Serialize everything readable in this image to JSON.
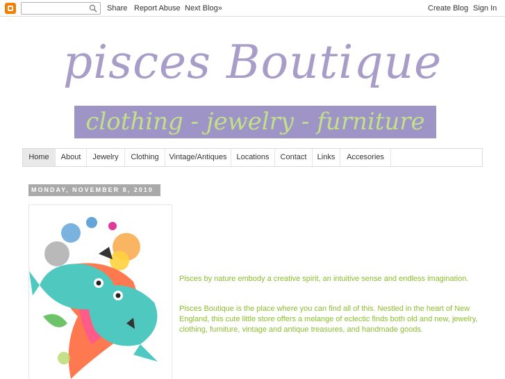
{
  "navbar": {
    "search_placeholder": "",
    "links": [
      "Share",
      "Report Abuse",
      "Next Blog»"
    ],
    "right_links": [
      "Create Blog",
      "Sign In"
    ]
  },
  "header": {
    "title": "pisces Boutique",
    "tagline": "clothing - jewelry - furniture"
  },
  "tabs": [
    "Home",
    "About",
    "Jewelry",
    "Clothing",
    "Vintage/Antiques",
    "Locations",
    "Contact",
    "Links",
    "Accesories"
  ],
  "post": {
    "date": "MONDAY, NOVEMBER 8, 2010",
    "paragraph1": "Pisces by nature embody a creative spirit, an intuitive sense and endless imagination.",
    "paragraph2": "Pisces Boutique is the place where you can find all of this. Nestled in the heart of New England, this cute little store offers a melange of eclectic finds both old and new, jewelry, clothing, furniture, vintage and antique treasures, and handmade goods."
  },
  "colors": {
    "title": "#a89cc8",
    "tagline_bg": "#9f94c6",
    "tagline_text": "#c2e08a",
    "body_text": "#8cbd2e",
    "date_bg": "#a9a9a9"
  }
}
